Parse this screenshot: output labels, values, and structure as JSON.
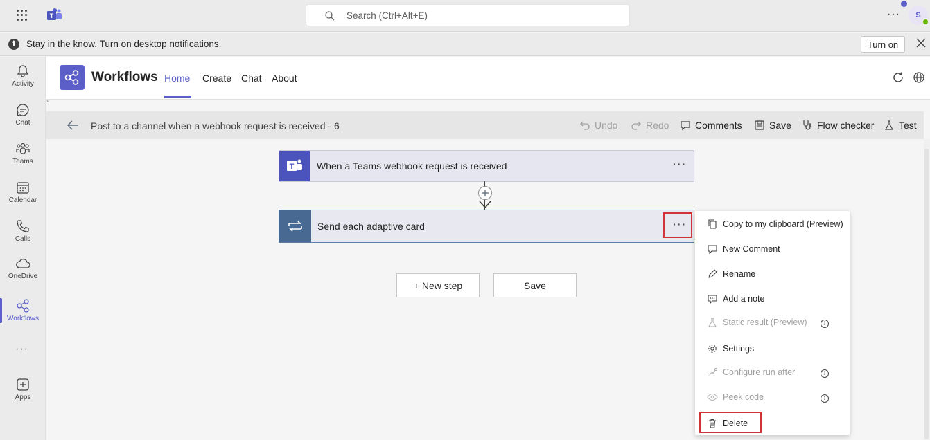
{
  "titlebar": {
    "search_placeholder": "Search (Ctrl+Alt+E)",
    "more": "···",
    "avatar_initial": "S"
  },
  "notification": {
    "message": "Stay in the know. Turn on desktop notifications.",
    "turn_on_label": "Turn on"
  },
  "rail": {
    "items": [
      {
        "label": "Activity",
        "icon": "bell-icon"
      },
      {
        "label": "Chat",
        "icon": "chat-icon"
      },
      {
        "label": "Teams",
        "icon": "teams-icon"
      },
      {
        "label": "Calendar",
        "icon": "calendar-icon"
      },
      {
        "label": "Calls",
        "icon": "phone-icon"
      },
      {
        "label": "OneDrive",
        "icon": "cloud-icon"
      },
      {
        "label": "Workflows",
        "icon": "workflows-icon",
        "active": true
      },
      {
        "label": "Apps",
        "icon": "apps-icon"
      }
    ],
    "more": "···"
  },
  "app": {
    "title": "Workflows",
    "tabs": [
      {
        "label": "Home",
        "active": true
      },
      {
        "label": "Create"
      },
      {
        "label": "Chat"
      },
      {
        "label": "About"
      }
    ]
  },
  "designer": {
    "tick": "`",
    "flow_name": "Post to a channel when a webhook request is received - 6",
    "commands": {
      "undo": "Undo",
      "redo": "Redo",
      "comments": "Comments",
      "save": "Save",
      "flow_checker": "Flow checker",
      "test": "Test"
    },
    "steps": [
      {
        "title": "When a Teams webhook request is received",
        "icon": "teams-icon"
      },
      {
        "title": "Send each adaptive card",
        "icon": "loop-icon"
      }
    ],
    "dots": "···",
    "new_step_label": "+ New step",
    "save_label": "Save"
  },
  "context_menu": {
    "items": [
      {
        "label": "Copy to my clipboard (Preview)",
        "icon": "copy-icon",
        "disabled": false
      },
      {
        "label": "New Comment",
        "icon": "comment-icon",
        "disabled": false
      },
      {
        "label": "Rename",
        "icon": "pencil-icon",
        "disabled": false
      },
      {
        "label": "Add a note",
        "icon": "note-icon",
        "disabled": false
      },
      {
        "label": "Static result (Preview)",
        "icon": "flask-icon",
        "disabled": true,
        "info": true
      },
      {
        "label": "Settings",
        "icon": "gear-icon",
        "disabled": false
      },
      {
        "label": "Configure run after",
        "icon": "run-after-icon",
        "disabled": true,
        "info": true
      },
      {
        "label": "Peek code",
        "icon": "eye-icon",
        "disabled": true,
        "info": true
      },
      {
        "label": "Delete",
        "icon": "trash-icon",
        "disabled": false
      }
    ],
    "info_glyph": "i"
  },
  "colors": {
    "accent": "#5b5fc7",
    "highlight": "#d13438",
    "loop_icon_bg": "#486991"
  }
}
